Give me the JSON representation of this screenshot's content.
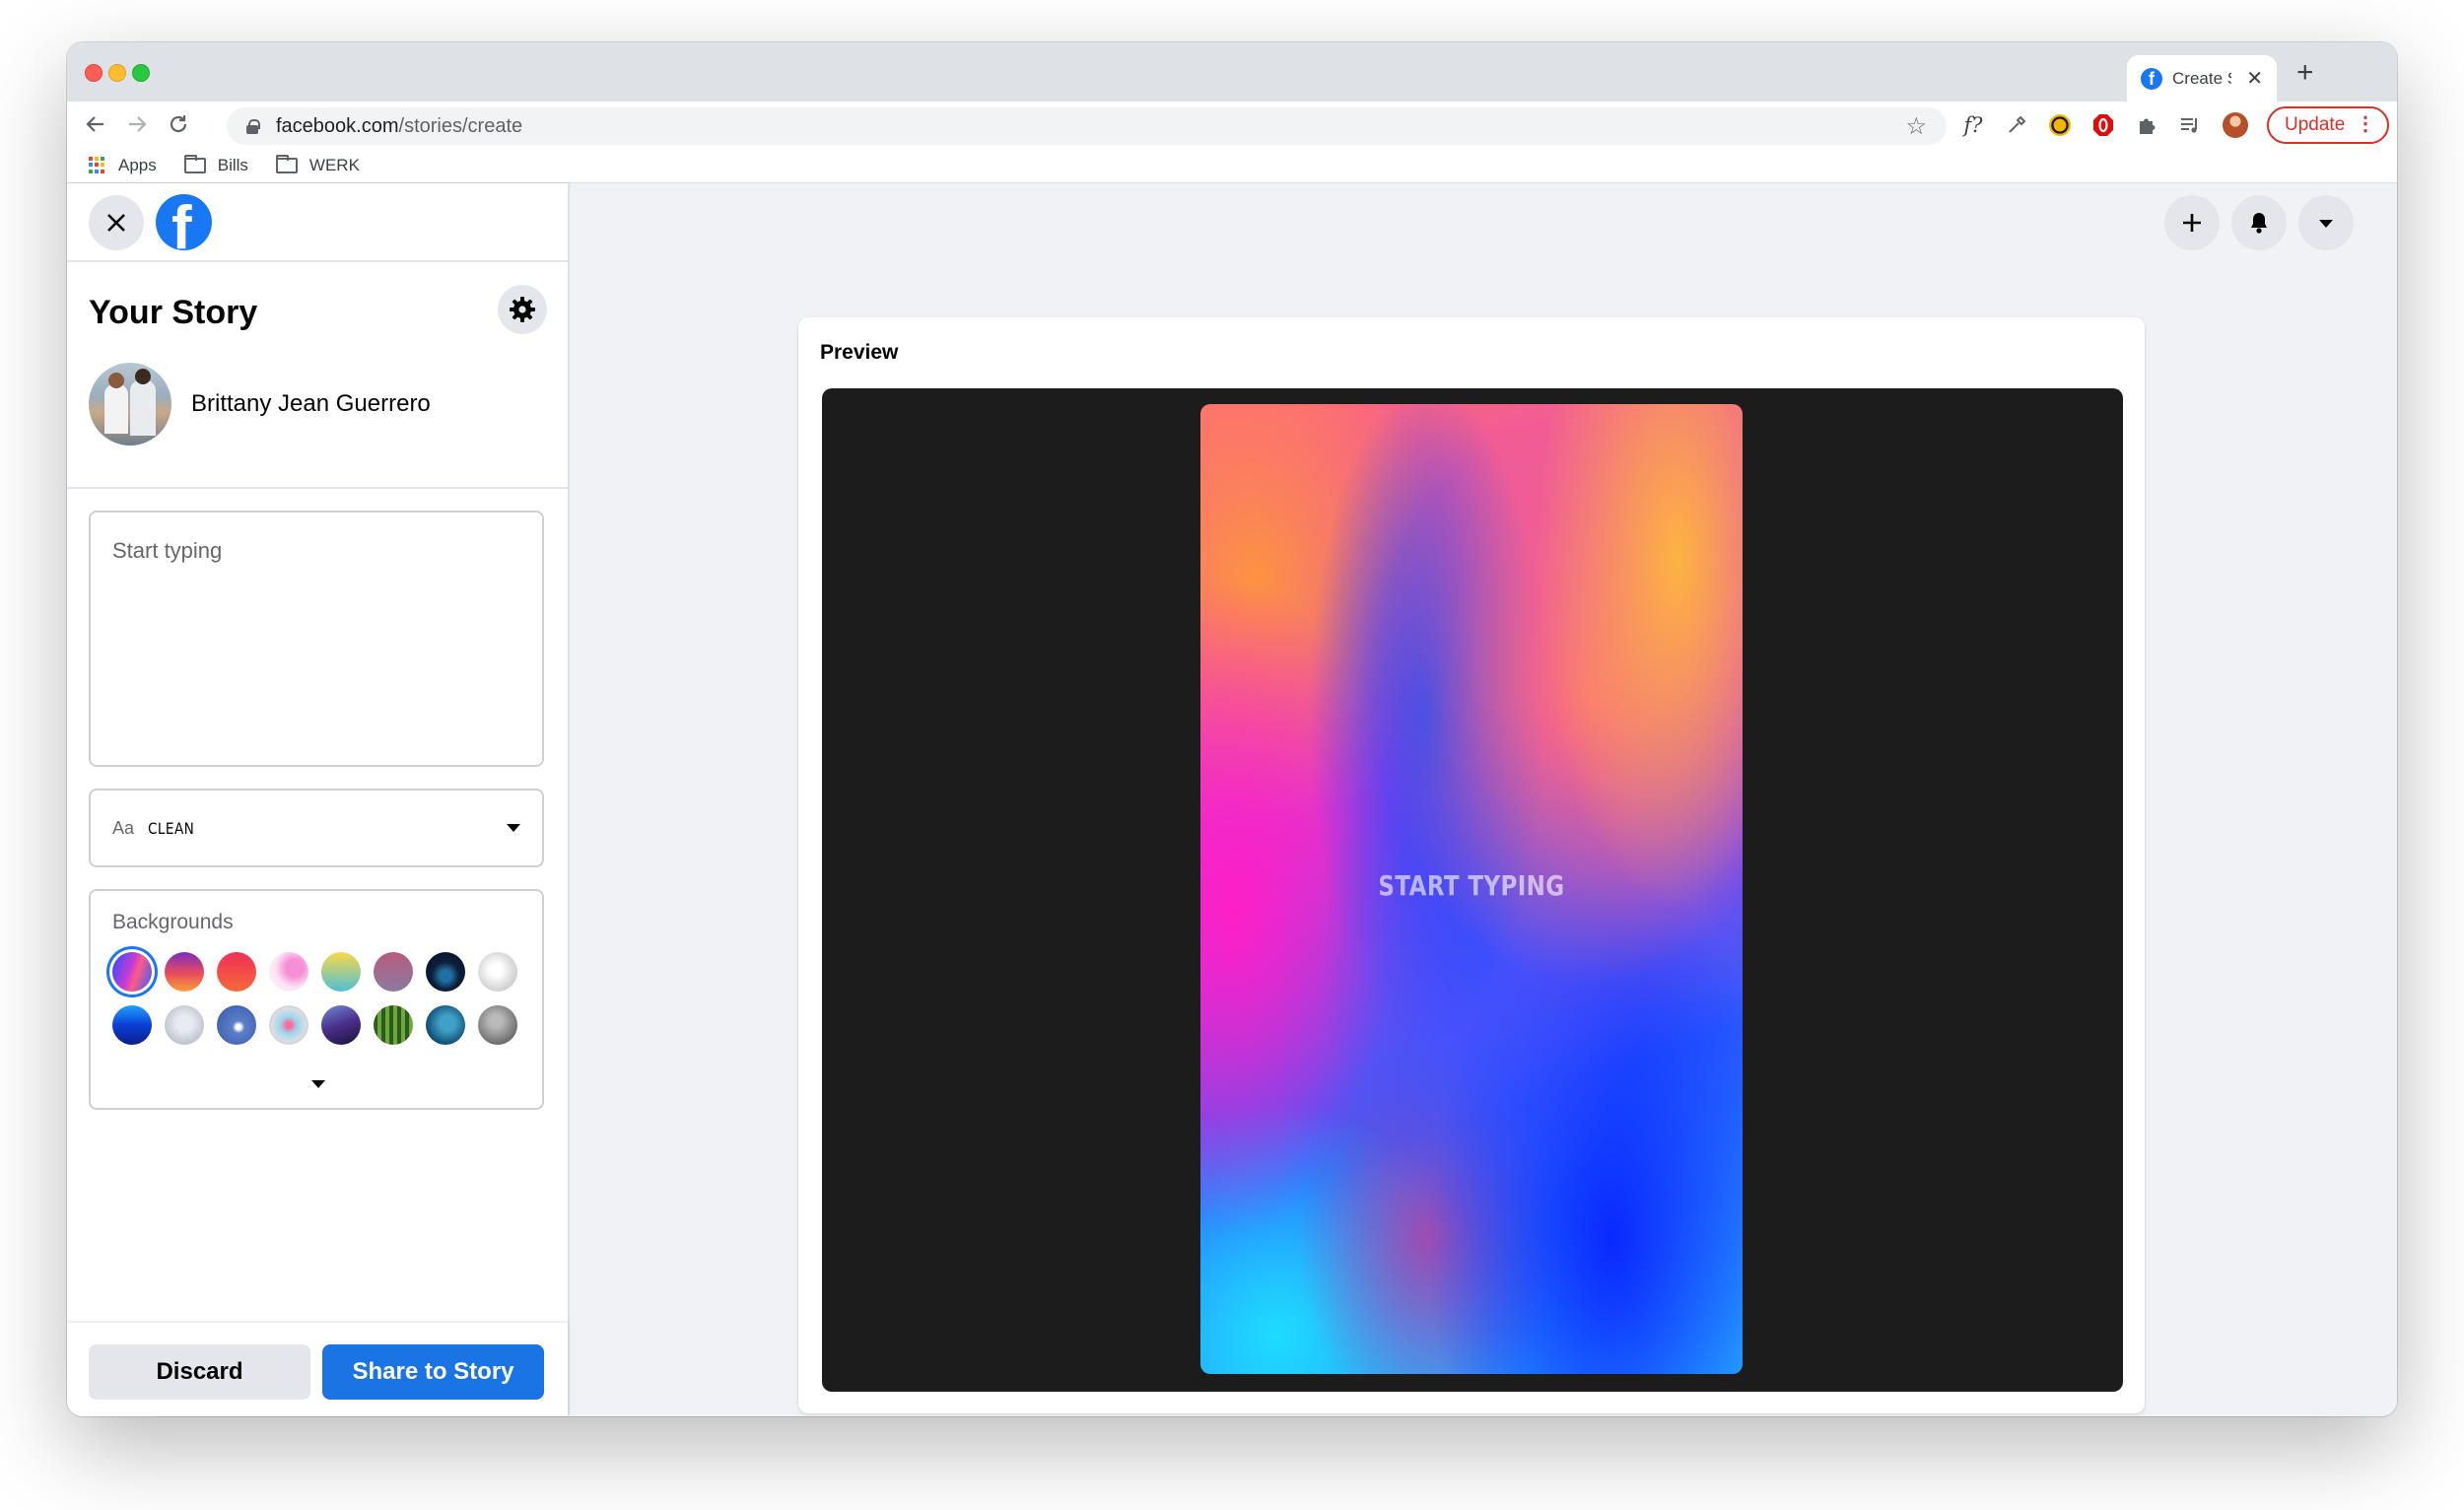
{
  "browser": {
    "tab": {
      "title": "Create Story"
    },
    "address": {
      "domain": "facebook.com",
      "path": "/stories/create"
    },
    "update_label": "Update",
    "bookmarks": [
      {
        "label": "Apps",
        "icon": "apps-grid-icon"
      },
      {
        "label": "Bills",
        "icon": "folder-icon"
      },
      {
        "label": "WERK",
        "icon": "folder-icon"
      }
    ]
  },
  "sidebar": {
    "title": "Your Story",
    "user_name": "Brittany Jean Guerrero",
    "text_placeholder": "Start typing",
    "font_prefix": "Aa",
    "font_name": "CLEAN",
    "backgrounds_label": "Backgrounds",
    "discard_label": "Discard",
    "share_label": "Share to Story"
  },
  "preview": {
    "title": "Preview",
    "story_text": "START TYPING"
  },
  "colors": {
    "facebook_blue": "#1877f2",
    "share_button": "#1b74e4",
    "update_red": "#d93025"
  }
}
